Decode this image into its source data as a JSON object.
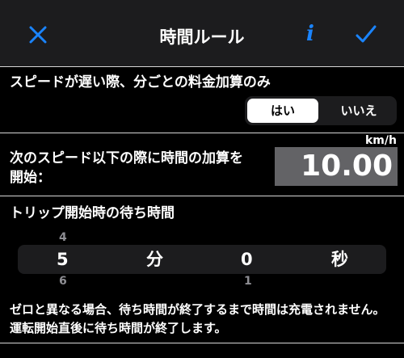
{
  "nav": {
    "title": "時間ルール",
    "info_glyph": "i",
    "accent": "#1a84ff"
  },
  "slow_only": {
    "label": "スピードが遅い際、分ごとの料金加算のみ",
    "options": [
      "はい",
      "いいえ"
    ],
    "selected": "はい"
  },
  "speed": {
    "label_line1": "次のスピード以下の際に時間の加算を",
    "label_line2": "開始：",
    "unit": "km/h",
    "value": "10.00"
  },
  "wait": {
    "label": "トリップ開始時の待ち時間",
    "minutes": {
      "above": "4",
      "value": "5",
      "below": "6",
      "unit": "分"
    },
    "seconds": {
      "value": "0",
      "below": "1",
      "unit": "秒"
    }
  },
  "note": "ゼロと異なる場合、待ち時間が終了するまで時間は充電されません。 運転開始直後に待ち時間が終了します。"
}
